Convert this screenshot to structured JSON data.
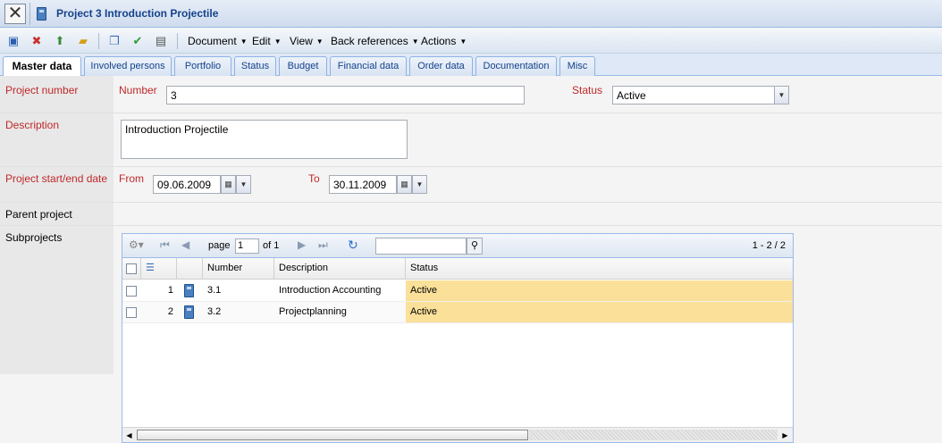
{
  "window": {
    "title": "Project 3 Introduction Projectile"
  },
  "toolbar": {
    "icons": [
      "save-icon",
      "delete-icon",
      "upload-icon",
      "folder-icon",
      "copy-icon",
      "refresh-ok-icon",
      "print-icon"
    ],
    "menus": [
      "Document",
      "Edit",
      "View",
      "Back references",
      "Actions"
    ]
  },
  "tabs": [
    "Master data",
    "Involved persons",
    "Portfolio",
    "Status",
    "Budget",
    "Financial data",
    "Order data",
    "Documentation",
    "Misc"
  ],
  "form": {
    "project_number_label": "Project number",
    "number_label": "Number",
    "number_value": "3",
    "status_label": "Status",
    "status_value": "Active",
    "description_label": "Description",
    "description_value": "Introduction Projectile",
    "dates_label": "Project start/end date",
    "from_label": "From",
    "from_value": "09.06.2009",
    "to_label": "To",
    "to_value": "30.11.2009",
    "parent_label": "Parent project",
    "subprojects_label": "Subprojects"
  },
  "grid": {
    "page_label": "page",
    "page_value": "1",
    "of_label": "of 1",
    "count": "1 - 2 / 2",
    "columns": [
      "Number",
      "Description",
      "Status"
    ],
    "rows": [
      {
        "index": "1",
        "number": "3.1",
        "description": "Introduction Accounting",
        "status": "Active"
      },
      {
        "index": "2",
        "number": "3.2",
        "description": "Projectplanning",
        "status": "Active"
      }
    ]
  },
  "colors": {
    "status_highlight": "#fbe09a",
    "label_red": "#c0282a",
    "title_blue": "#15428b"
  }
}
